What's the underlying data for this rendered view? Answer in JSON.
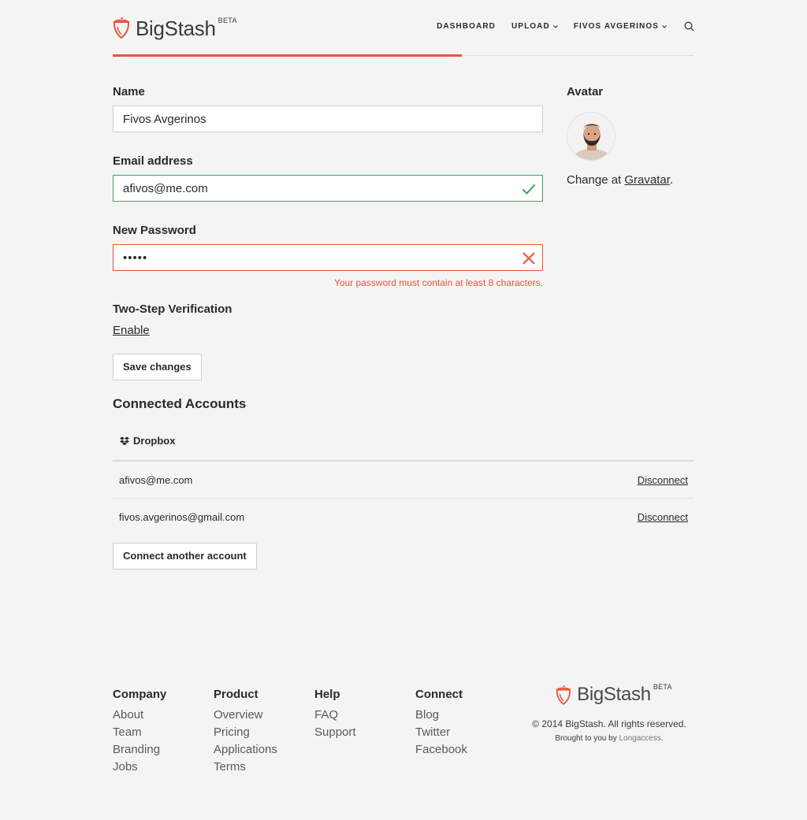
{
  "brand": {
    "name": "BigStash",
    "badge": "BETA",
    "accent": "#e8543a"
  },
  "nav": {
    "dashboard": "DASHBOARD",
    "upload": "UPLOAD",
    "user": "FIVOS AVGERINOS"
  },
  "form": {
    "name_label": "Name",
    "name_value": "Fivos Avgerinos",
    "email_label": "Email address",
    "email_value": "afivos@me.com",
    "password_label": "New Password",
    "password_value": "•••••",
    "password_error": "Your password must contain at least 8 characters.",
    "twostep_label": "Two-Step Verification",
    "twostep_link": "Enable",
    "save_label": "Save changes"
  },
  "avatar": {
    "label": "Avatar",
    "change_prefix": "Change at ",
    "change_link": "Gravatar",
    "change_suffix": "."
  },
  "accounts": {
    "title": "Connected Accounts",
    "provider": "Dropbox",
    "rows": [
      {
        "email": "afivos@me.com",
        "action": "Disconnect"
      },
      {
        "email": "fivos.avgerinos@gmail.com",
        "action": "Disconnect"
      }
    ],
    "connect_label": "Connect another account"
  },
  "footer": {
    "columns": [
      {
        "title": "Company",
        "items": [
          "About",
          "Team",
          "Branding",
          "Jobs"
        ]
      },
      {
        "title": "Product",
        "items": [
          "Overview",
          "Pricing",
          "Applications",
          "Terms"
        ]
      },
      {
        "title": "Help",
        "items": [
          "FAQ",
          "Support"
        ]
      },
      {
        "title": "Connect",
        "items": [
          "Blog",
          "Twitter",
          "Facebook"
        ]
      }
    ],
    "copyright": "© 2014 BigStash. All rights reserved.",
    "brought_prefix": "Brought to you by ",
    "brought_link": "Longaccess",
    "brought_suffix": "."
  }
}
